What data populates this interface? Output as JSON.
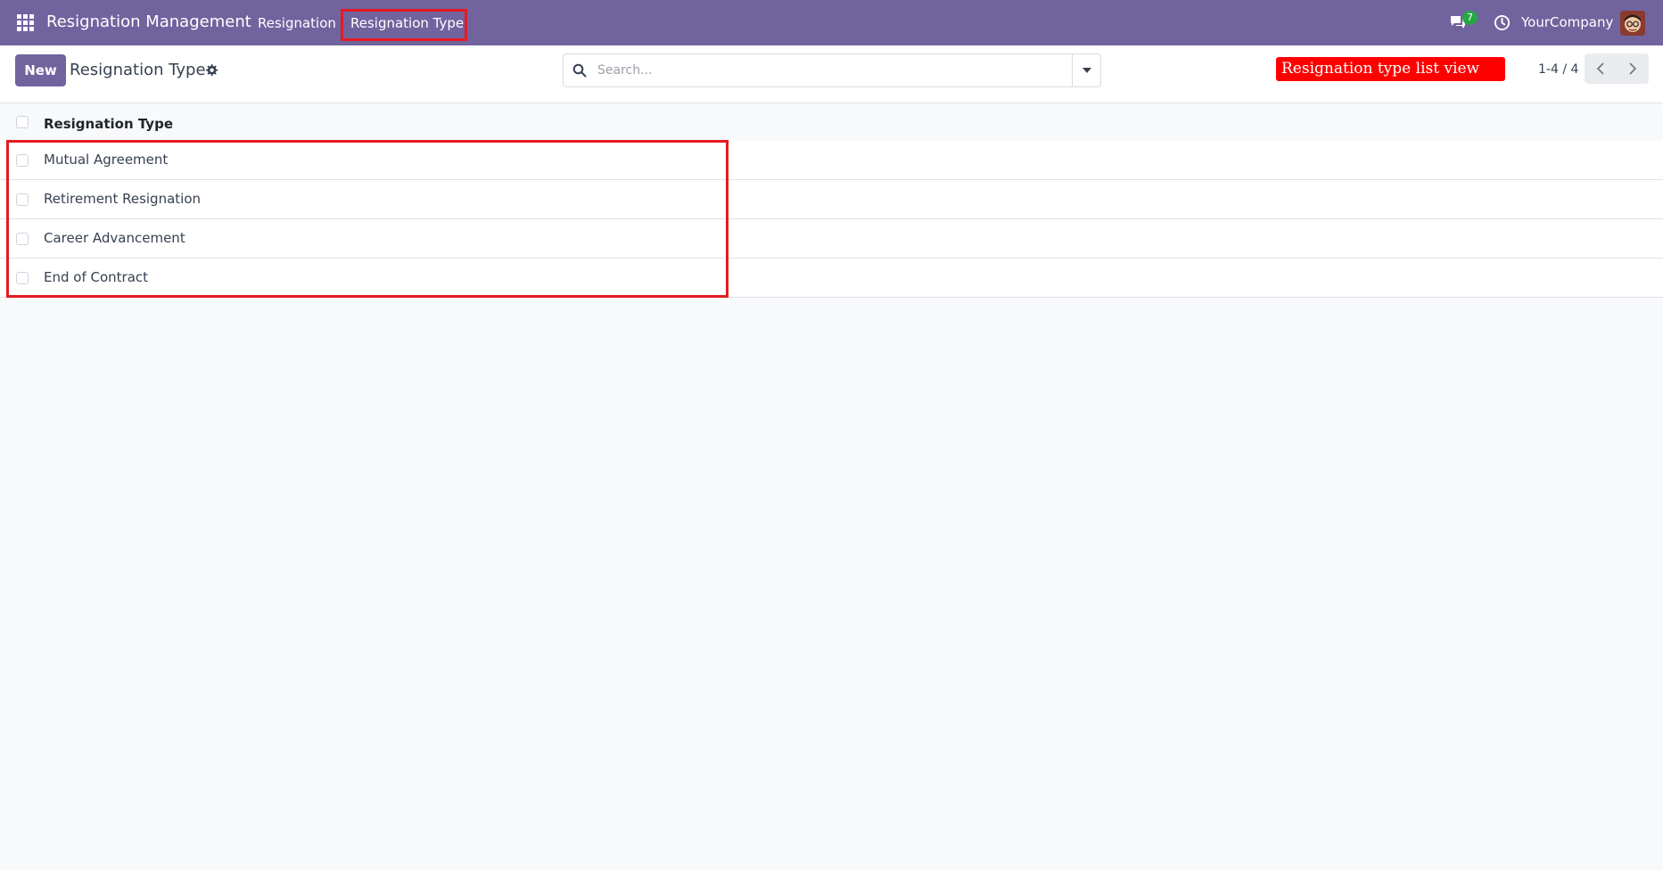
{
  "navbar": {
    "brand": "Resignation Management",
    "menu": [
      {
        "label": "Resignation"
      },
      {
        "label": "Resignation Type"
      }
    ],
    "messages_count": "7",
    "company": "YourCompany",
    "bg_color": "#71639e"
  },
  "control_panel": {
    "new_label": "New",
    "title": "Resignation Type",
    "search_placeholder": "Search...",
    "annotation": "Resignation type list view",
    "pager": "1-4 / 4"
  },
  "list": {
    "column": "Resignation Type",
    "rows": [
      {
        "name": "Mutual Agreement"
      },
      {
        "name": "Retirement Resignation"
      },
      {
        "name": "Career Advancement"
      },
      {
        "name": "End of Contract"
      }
    ]
  },
  "colors": {
    "accent": "#71639e",
    "highlight": "#e31b23",
    "annotation_bg": "#ff0000"
  }
}
